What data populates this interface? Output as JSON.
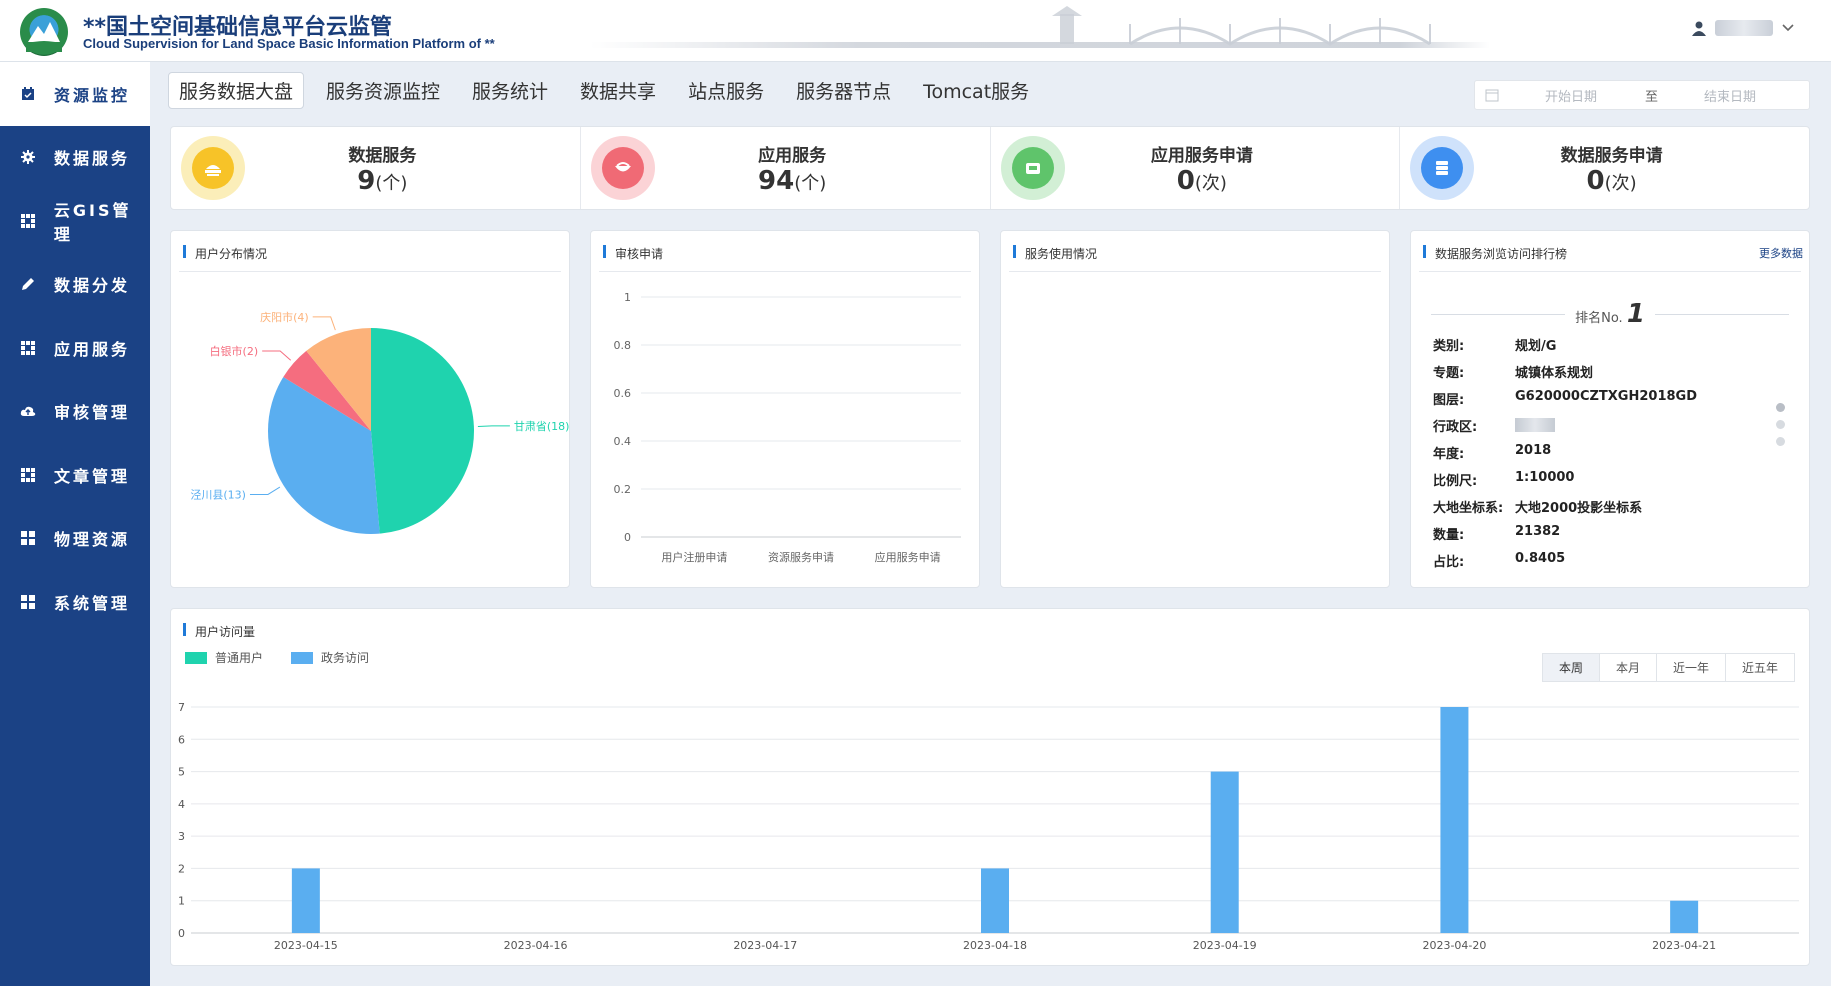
{
  "header": {
    "title_cn": "**国土空间基础信息平台云监管",
    "title_en": "Cloud Supervision for Land Space Basic Information Platform of **",
    "user_icon": "user-icon",
    "dropdown_icon": "chevron-down-icon"
  },
  "sidebar": {
    "items": [
      {
        "label": "资源监控",
        "icon": "calendar-icon",
        "active": true
      },
      {
        "label": "数据服务",
        "icon": "gear-icon",
        "active": false
      },
      {
        "label": "云GIS管理",
        "icon": "grid-icon",
        "active": false
      },
      {
        "label": "数据分发",
        "icon": "pencil-icon",
        "active": false
      },
      {
        "label": "应用服务",
        "icon": "grid-icon",
        "active": false
      },
      {
        "label": "审核管理",
        "icon": "cloud-icon",
        "active": false
      },
      {
        "label": "文章管理",
        "icon": "grid-icon",
        "active": false
      },
      {
        "label": "物理资源",
        "icon": "tiles-icon",
        "active": false
      },
      {
        "label": "系统管理",
        "icon": "tiles-icon",
        "active": false
      }
    ]
  },
  "tabs": [
    "服务数据大盘",
    "服务资源监控",
    "服务统计",
    "数据共享",
    "站点服务",
    "服务器节点",
    "Tomcat服务"
  ],
  "date_range": {
    "start_placeholder": "开始日期",
    "separator": "至",
    "end_placeholder": "结束日期"
  },
  "stats": [
    {
      "label": "数据服务",
      "value": "9",
      "unit": "(个)",
      "color": "#f7c328",
      "ring": "#fbeeb9"
    },
    {
      "label": "应用服务",
      "value": "94",
      "unit": "(个)",
      "color": "#f06a75",
      "ring": "#fbd3d6"
    },
    {
      "label": "应用服务申请",
      "value": "0",
      "unit": "(次)",
      "color": "#5fc46b",
      "ring": "#d2efd5"
    },
    {
      "label": "数据服务申请",
      "value": "0",
      "unit": "(次)",
      "color": "#3e8ff0",
      "ring": "#cfe2fb"
    }
  ],
  "panels": {
    "user_dist": {
      "title": "用户分布情况"
    },
    "audit": {
      "title": "审核申请"
    },
    "usage": {
      "title": "服务使用情况"
    },
    "ranking": {
      "title": "数据服务浏览访问排行榜",
      "more": "更多数据",
      "rank_prefix": "排名No.",
      "rank_num": "1",
      "fields": [
        {
          "k": "类别:",
          "v": "规划/G"
        },
        {
          "k": "专题:",
          "v": "城镇体系规划"
        },
        {
          "k": "图层:",
          "v": "G620000CZTXGH2018GD"
        },
        {
          "k": "行政区:",
          "v": ""
        },
        {
          "k": "年度:",
          "v": "2018"
        },
        {
          "k": "比例尺:",
          "v": "1:10000"
        },
        {
          "k": "大地坐标系:",
          "v": "大地2000投影坐标系"
        },
        {
          "k": "数量:",
          "v": "21382"
        },
        {
          "k": "占比:",
          "v": "0.8405"
        }
      ]
    },
    "visits": {
      "title": "用户访问量",
      "ranges": [
        "本周",
        "本月",
        "近一年",
        "近五年"
      ],
      "active_range": "本周"
    }
  },
  "chart_data": [
    {
      "type": "pie",
      "title": "用户分布情况",
      "slices": [
        {
          "label": "甘肃省(18)",
          "value": 18,
          "color": "#1fd3ae"
        },
        {
          "label": "泾川县(13)",
          "value": 13,
          "color": "#5aaef0"
        },
        {
          "label": "白银市(2)",
          "value": 2,
          "color": "#f56d7f"
        },
        {
          "label": "庆阳市(4)",
          "value": 4,
          "color": "#fcb27a"
        }
      ]
    },
    {
      "type": "line",
      "title": "审核申请",
      "categories": [
        "用户注册申请",
        "资源服务申请",
        "应用服务申请"
      ],
      "yticks": [
        "0",
        "0.2",
        "0.4",
        "0.6",
        "0.8",
        "1"
      ],
      "ylim": [
        0,
        1
      ]
    },
    {
      "type": "bar",
      "title": "用户访问量",
      "categories": [
        "2023-04-15",
        "2023-04-16",
        "2023-04-17",
        "2023-04-18",
        "2023-04-19",
        "2023-04-20",
        "2023-04-21"
      ],
      "series": [
        {
          "name": "普通用户",
          "color": "#1fd3ae",
          "values": [
            0,
            0,
            0,
            0,
            0,
            0,
            0
          ]
        },
        {
          "name": "政务访问",
          "color": "#5aaef0",
          "values": [
            2,
            0,
            0,
            2,
            5,
            7,
            1
          ]
        }
      ],
      "yticks": [
        "0",
        "1",
        "2",
        "3",
        "4",
        "5",
        "6",
        "7"
      ],
      "ylim": [
        0,
        7
      ]
    }
  ]
}
